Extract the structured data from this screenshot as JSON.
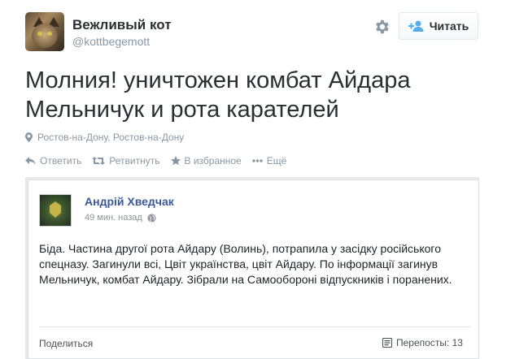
{
  "user": {
    "display_name": "Вежливый кот",
    "screen_name": "@kottbegemott"
  },
  "header": {
    "settings_icon": "gear-icon",
    "follow_label": "Читать"
  },
  "tweet": {
    "text": "Молния! уничтожен комбат Айдара Мельничук и рота карателей",
    "location": "Ростов-на-Дону, Ростов-на-Дону"
  },
  "actions": {
    "reply": "Ответить",
    "retweet": "Ретвитнуть",
    "favorite": "В избранное",
    "more": "Ещё"
  },
  "embedded_post": {
    "author": "Андрій Хведчак",
    "time": "49 мин. назад",
    "body": "Біда. Частина другої рота Айдару (Волинь), потрапила у засідку російського спецназу. Загинули всі, Цвіт українства, цвіт Айдару. По інформації загинув Мельничук, комбат Айдару. Зібрали на Самообороні відпускників і поранених.",
    "share": "Поделиться",
    "reposts": "Перепосты: 13"
  },
  "colors": {
    "text": "#292f33",
    "muted": "#8899a6",
    "fb_blue": "#3b5998"
  }
}
